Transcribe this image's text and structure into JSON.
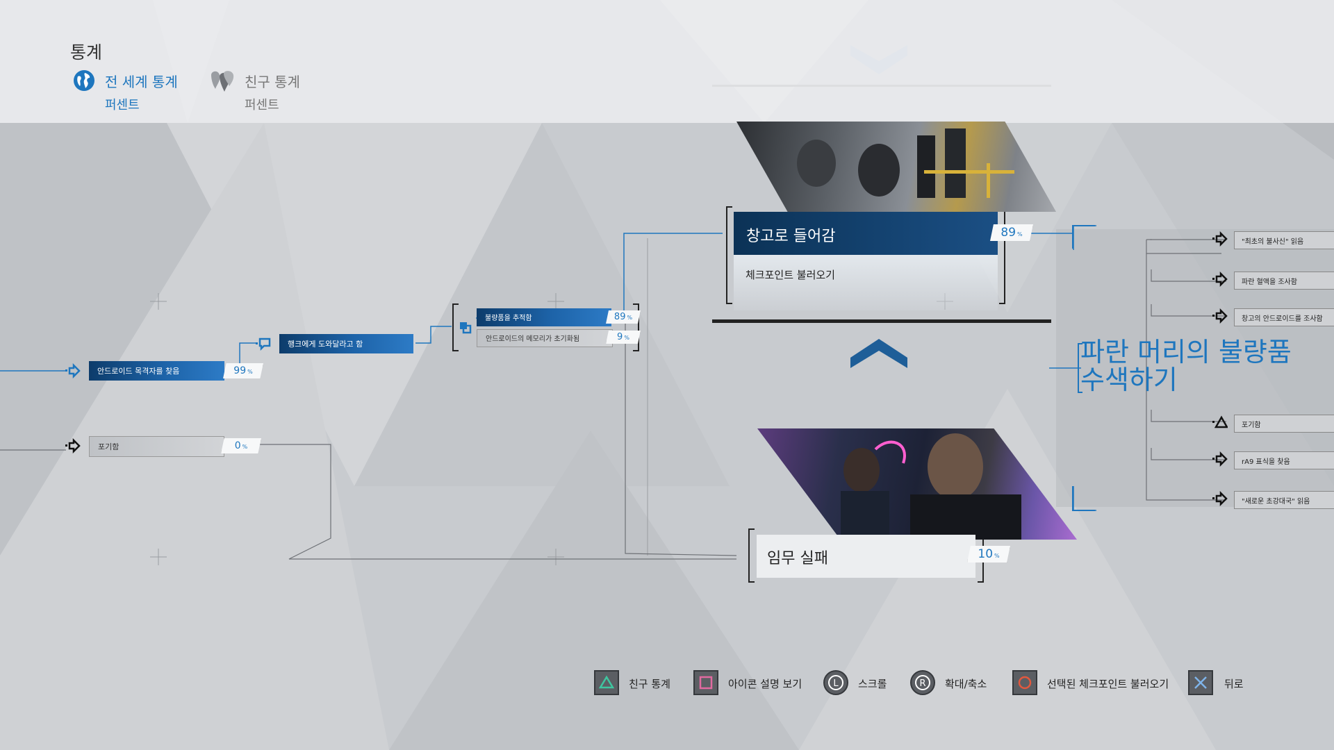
{
  "header": {
    "title": "통계",
    "tabs": [
      {
        "label": "전 세계 통계",
        "sub": "퍼센트",
        "active": true,
        "icon": "globe-icon"
      },
      {
        "label": "친구 통계",
        "sub": "퍼센트",
        "active": false,
        "icon": "friends-icon"
      }
    ]
  },
  "flowchart": {
    "left_nodes": [
      {
        "label": "안드로이드 목격자를 찾음",
        "percent": "99",
        "style": "blue"
      },
      {
        "label": "포기함",
        "percent": "0",
        "style": "gray"
      },
      {
        "label": "행크에게 도와달라고 함",
        "style": "blue"
      }
    ],
    "mid_nodes": [
      {
        "label": "불량품을 추적함",
        "percent": "89",
        "style": "blue"
      },
      {
        "label": "안드로이드의 메모리가 초기화됨",
        "percent": "9",
        "style": "gray"
      }
    ],
    "unit": "%",
    "main_card": {
      "title": "창고로 들어감",
      "subtitle": "체크포인트 불러오기",
      "percent": "89"
    },
    "fail_card": {
      "title": "임무 실패",
      "percent": "10"
    },
    "objective": [
      "파란 머리의 불량품",
      "수색하기"
    ],
    "right_nodes": [
      {
        "label": "\"최초의 불사신\" 읽음",
        "icon": "arrow-icon"
      },
      {
        "label": "파란 혈액을 조사함",
        "icon": "arrow-icon"
      },
      {
        "label": "창고의 안드로이드를 조사함",
        "icon": "arrow-icon"
      },
      {
        "label": "포기함",
        "icon": "triangle-icon"
      },
      {
        "label": "rA9 표식을 찾음",
        "icon": "arrow-icon"
      },
      {
        "label": "\"새로운 초강대국\" 읽음",
        "icon": "arrow-icon"
      }
    ]
  },
  "controls": [
    {
      "label": "친구 통계",
      "icon": "triangle-button-icon",
      "color": "#3fc6a0"
    },
    {
      "label": "아이콘 설명 보기",
      "icon": "square-button-icon",
      "color": "#e06aa0"
    },
    {
      "label": "스크롤",
      "icon": "left-stick-icon",
      "color": "#ffffff"
    },
    {
      "label": "확대/축소",
      "icon": "right-stick-icon",
      "color": "#ffffff"
    },
    {
      "label": "선택된 체크포인트 불러오기",
      "icon": "circle-button-icon",
      "color": "#e2583e"
    },
    {
      "label": "뒤로",
      "icon": "cross-button-icon",
      "color": "#7fb4ea"
    }
  ],
  "colors": {
    "accent": "#1e76be",
    "dark_blue": "#0b3256",
    "background": "#c9ccd0"
  }
}
